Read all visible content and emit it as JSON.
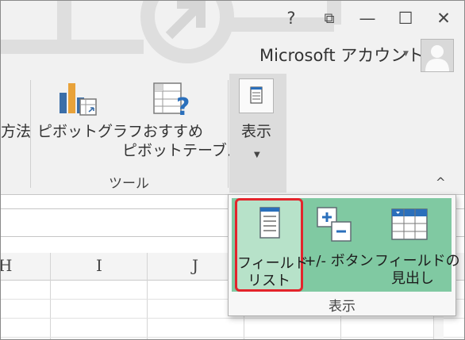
{
  "window_controls": {
    "help": "?",
    "restore": "⧉",
    "minimize": "—",
    "maximize": "☐",
    "close": "✕"
  },
  "account": {
    "name": "Microsoft アカウント",
    "dropdown": "▼"
  },
  "ribbon": {
    "left_partial": "方法",
    "pivot_chart": "ピボットグラフ",
    "recommended_line1": "おすすめ",
    "recommended_line2": "ピボットテーブル",
    "group_tools": "ツール",
    "show_label": "表示",
    "show_arrow": "▼",
    "collapse": "^"
  },
  "grid": {
    "columns": [
      "H",
      "I",
      "J"
    ]
  },
  "popup": {
    "field_list_line1": "フィールド",
    "field_list_line2": "リスト",
    "buttons_label": "+/- ボタン",
    "headers_line1": "フィールドの",
    "headers_line2": "見出し",
    "footer": "表示"
  },
  "colors": {
    "highlight_border": "#e3242b",
    "popup_green": "#80c9a2",
    "selected_green": "#b7e2c9",
    "ribbon_bg": "#f1f1f1"
  }
}
